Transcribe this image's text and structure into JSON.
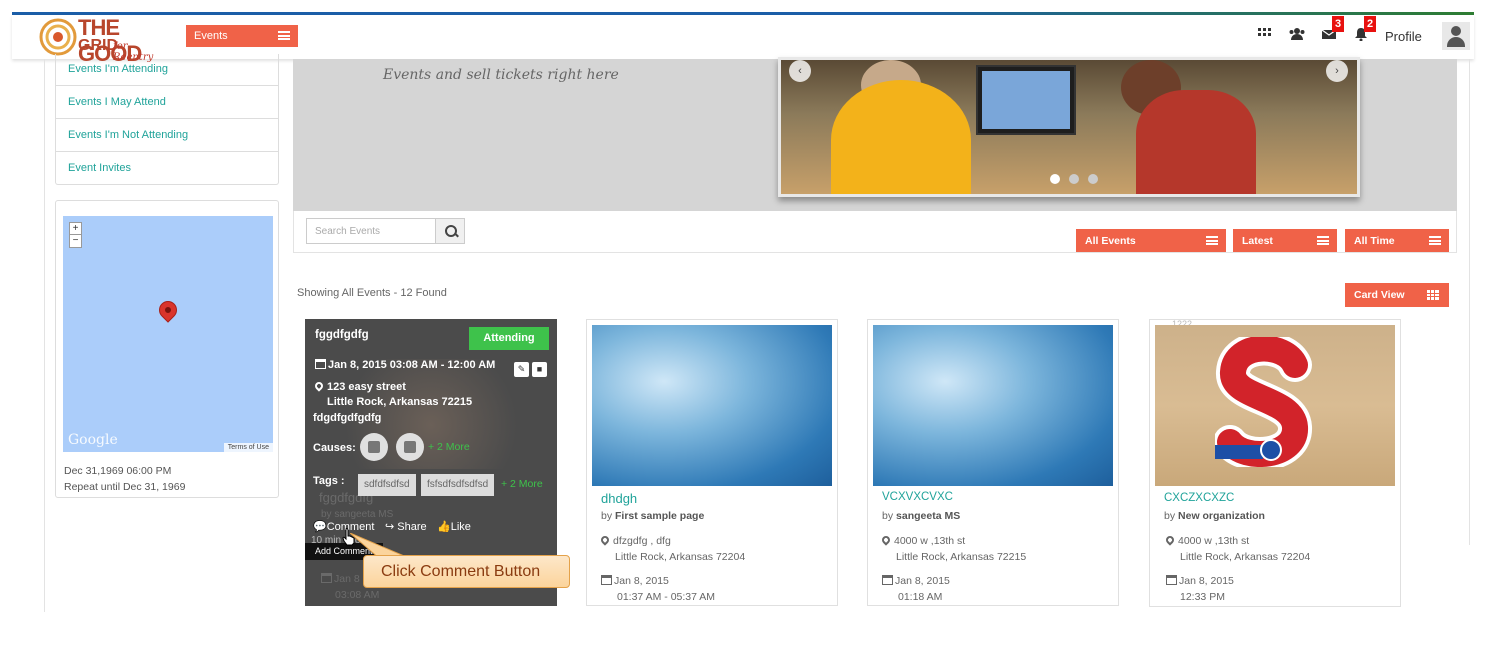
{
  "header": {
    "logo": {
      "line1": "THE GOOD",
      "line2": "GRID",
      "tagline": "for Reentry"
    },
    "nav_dropdown_label": "Events",
    "icons": [
      "apps-grid-icon",
      "community-icon",
      "mail-icon",
      "bell-icon"
    ],
    "mail_badge": "3",
    "notifications_badge": "2",
    "profile_label": "Profile"
  },
  "sidebar": {
    "items": [
      {
        "label": "Events I'm Attending"
      },
      {
        "label": "Events I May Attend"
      },
      {
        "label": "Events I'm Not Attending"
      },
      {
        "label": "Event Invites"
      }
    ],
    "map": {
      "zoom_in": "+",
      "zoom_out": "−",
      "provider": "Google",
      "terms": "Terms of Use",
      "date_line": "Dec 31,1969 06:00 PM",
      "repeat_line": "Repeat until Dec 31, 1969"
    }
  },
  "hero": {
    "tagline": "Events and sell tickets right here",
    "prev": "‹",
    "next": "›"
  },
  "toolbar": {
    "search_placeholder": "Search Events",
    "filters": [
      "All Events",
      "Latest",
      "All Time"
    ]
  },
  "results": {
    "showing_text": "Showing All Events - 12 Found",
    "view_label": "Card View"
  },
  "featured_card": {
    "title": "fggdfgdfg",
    "status": "Attending",
    "date": "Jan 8, 2015 03:08 AM - 12:00 AM",
    "address1": "123 easy street",
    "address2": "Little Rock, Arkansas 72215",
    "description": "fdgdfgdfgdfg",
    "causes_label": "Causes:",
    "causes_more": "+ 2 More",
    "tags_label": "Tags :",
    "tags": [
      "sdfdfsdfsd",
      "fsfsdfsdfsdfsd"
    ],
    "tags_more": "+ 2 More",
    "ghost_title": "fggdfgdfg",
    "ghost_by": "by sangeeta MS",
    "actions": {
      "comment": "Comment",
      "share": "Share",
      "like": "Like"
    },
    "time_ago": "10 min ago",
    "tooltip": "Add Comment",
    "ghost_date": "Jan 8",
    "ghost_time": "03:08 AM"
  },
  "cards": [
    {
      "title": "dhdgh",
      "by_prefix": "by",
      "by": "First sample page",
      "loc1": "dfzgdfg , dfg",
      "loc2": "Little Rock, Arkansas 72204",
      "date": "Jan 8, 2015",
      "time": "01:37 AM - 05:37 AM"
    },
    {
      "title": "VCXVXCVXC",
      "by_prefix": "by",
      "by": "sangeeta MS",
      "loc1": "4000 w ,13th st",
      "loc2": "Little Rock, Arkansas 72215",
      "date": "Jan 8, 2015",
      "time": "01:18 AM"
    },
    {
      "title": "CXCZXCXZC",
      "by_prefix": "by",
      "by": "New organization",
      "loc1": "4000 w ,13th st",
      "loc2": "Little Rock, Arkansas 72204",
      "date": "Jan 8, 2015",
      "time": "12:33 PM",
      "overlay": "1222"
    }
  ],
  "callout": {
    "text": "Click Comment Button"
  }
}
